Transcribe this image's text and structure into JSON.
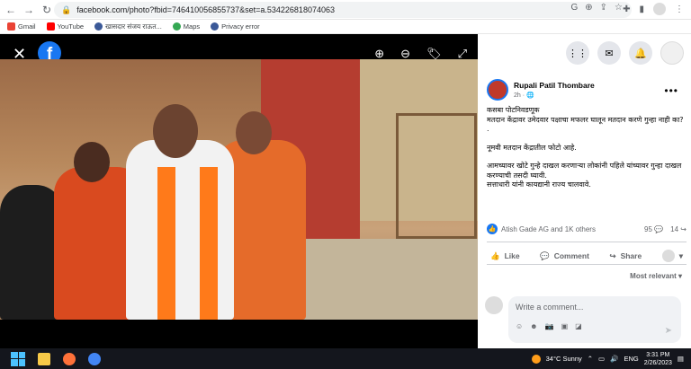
{
  "browser": {
    "url": "facebook.com/photo?fbid=746410056855737&set=a.534226818074063",
    "bookmarks": [
      "Gmail",
      "YouTube",
      "खासदार संजय राऊत...",
      "Maps",
      "Privacy error"
    ]
  },
  "post": {
    "author": "Rupali Patil Thombare",
    "time": "2h ·",
    "text": {
      "line1": "कसबा पोटनिवडणूक",
      "line2": "मतदान केंद्रावर उमेदवार पक्षाचा मफलर घालून मतदान करणे गुन्हा नाही का? .",
      "line3": "नूमवी मतदान केंद्रातील फोटो आहे.",
      "line4": "आमच्यावर खोटे गुन्हे दाखल करणाऱ्या लोकांनी पहिले यांच्यावर गुन्हा दाखल करण्याची तसदी घ्यावी.",
      "line5": "सत्ताधारी यांनी कायद्यानी राज्य चालवावे."
    },
    "reactions_text": "Atish Gade AG and 1K others",
    "comments_count": "95",
    "shares_count": "14",
    "actions": {
      "like": "Like",
      "comment": "Comment",
      "share": "Share"
    },
    "sort": "Most relevant",
    "comment_placeholder": "Write a comment..."
  },
  "taskbar": {
    "weather": "34°C  Sunny",
    "lang": "ENG",
    "time": "3:31 PM",
    "date": "2/26/2023"
  },
  "colors": {
    "fb_blue": "#1877f2",
    "taskbar": "#14161d"
  }
}
